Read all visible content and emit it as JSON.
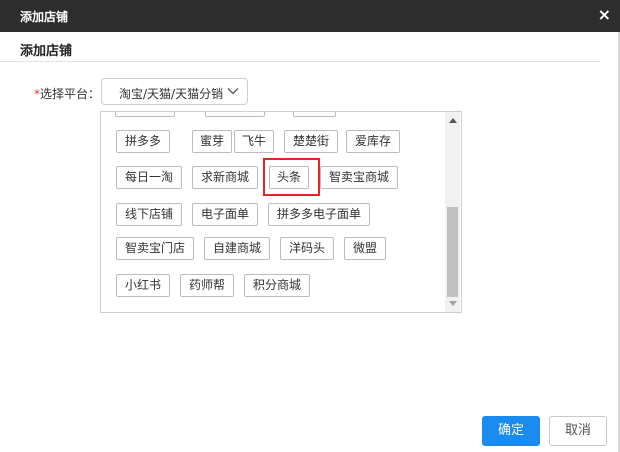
{
  "dialog": {
    "title": "添加店铺",
    "close_label": "×",
    "section_title": "添加店铺"
  },
  "form": {
    "required_mark": "*",
    "platform_label": "选择平台：",
    "platform_value": "淘宝/天猫/天猫分销"
  },
  "platforms": {
    "row1": [
      "拼多多",
      "蜜芽",
      "飞牛",
      "楚楚街",
      "爱库存"
    ],
    "row2": [
      "每日一淘",
      "求新商城",
      "头条",
      "智卖宝商城"
    ],
    "row3": [
      "线下店铺",
      "电子面单",
      "拼多多电子面单"
    ],
    "row4": [
      "智卖宝门店",
      "自建商城",
      "洋码头",
      "微盟"
    ],
    "row5": [
      "小红书",
      "药师帮",
      "积分商城"
    ],
    "highlighted": "头条"
  },
  "buttons": {
    "ok": "确定",
    "cancel": "取消"
  },
  "colors": {
    "titlebar": "#2d2d2d",
    "primary": "#1a8cf0",
    "highlight": "#e0262b",
    "required": "#e33333"
  }
}
